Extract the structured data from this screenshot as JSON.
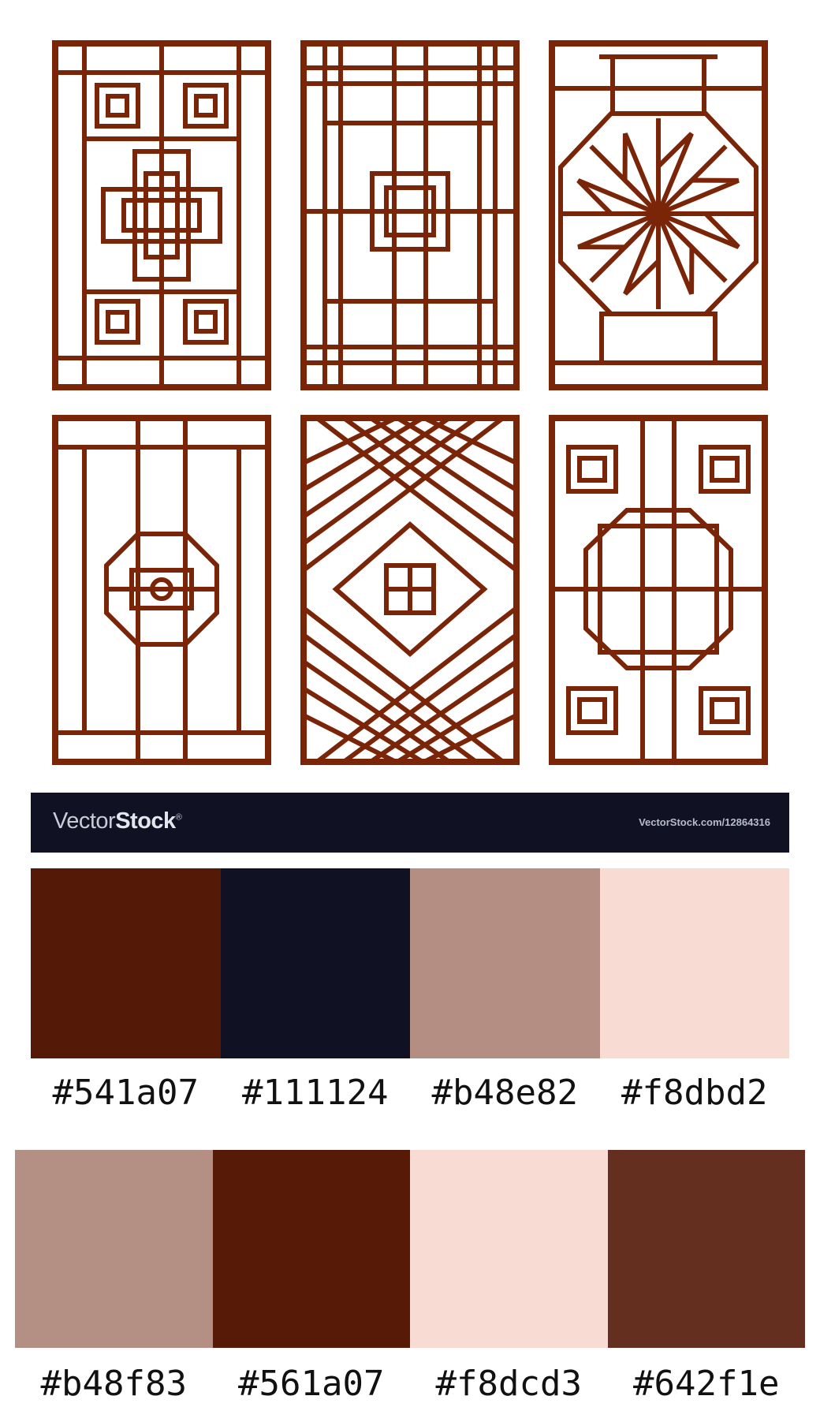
{
  "artwork": {
    "stroke_color": "#7a2408",
    "panels": [
      "greek-key-cross-panel",
      "nested-squares-panel",
      "octagon-star-panel",
      "octagon-medallion-panel",
      "diamond-lattice-panel",
      "circle-of-squares-panel"
    ]
  },
  "watermark": {
    "brand_regular": "Vector",
    "brand_bold": "Stock",
    "registered_mark": "®",
    "url": "VectorStock.com/12864316",
    "background": "#111124"
  },
  "palette_primary": [
    {
      "hex": "#541a07",
      "label": "#541a07"
    },
    {
      "hex": "#111124",
      "label": "#111124"
    },
    {
      "hex": "#b48e82",
      "label": "#b48e82"
    },
    {
      "hex": "#f8dbd2",
      "label": "#f8dbd2"
    }
  ],
  "palette_secondary": [
    {
      "hex": "#b48f83",
      "label": "#b48f83"
    },
    {
      "hex": "#561a07",
      "label": "#561a07"
    },
    {
      "hex": "#f8dcd3",
      "label": "#f8dcd3"
    },
    {
      "hex": "#642f1e",
      "label": "#642f1e"
    }
  ]
}
